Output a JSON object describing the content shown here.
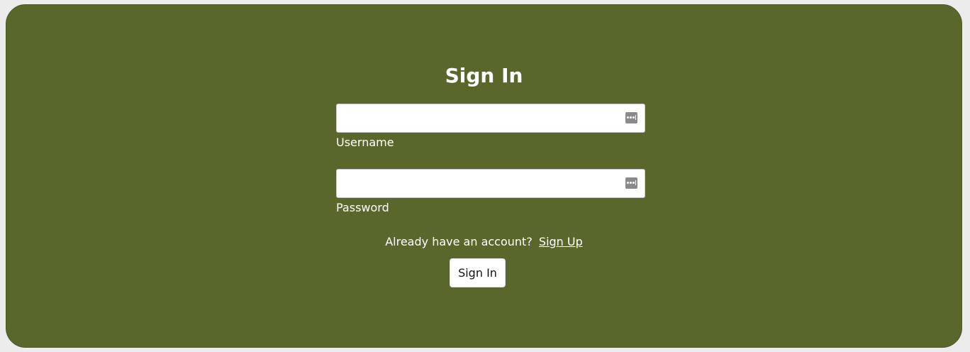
{
  "form": {
    "title": "Sign In",
    "username": {
      "label": "Username",
      "value": "",
      "placeholder": ""
    },
    "password": {
      "label": "Password",
      "value": "",
      "placeholder": ""
    },
    "signup_prompt": "Already have an account?",
    "signup_link": "Sign Up",
    "submit_label": "Sign In"
  },
  "icons": {
    "field_icon": "password-manager-key-icon"
  },
  "colors": {
    "card_background": "#5a672c",
    "page_background": "#ececec",
    "text": "#ffffff",
    "icon": "#8a8a8a"
  }
}
